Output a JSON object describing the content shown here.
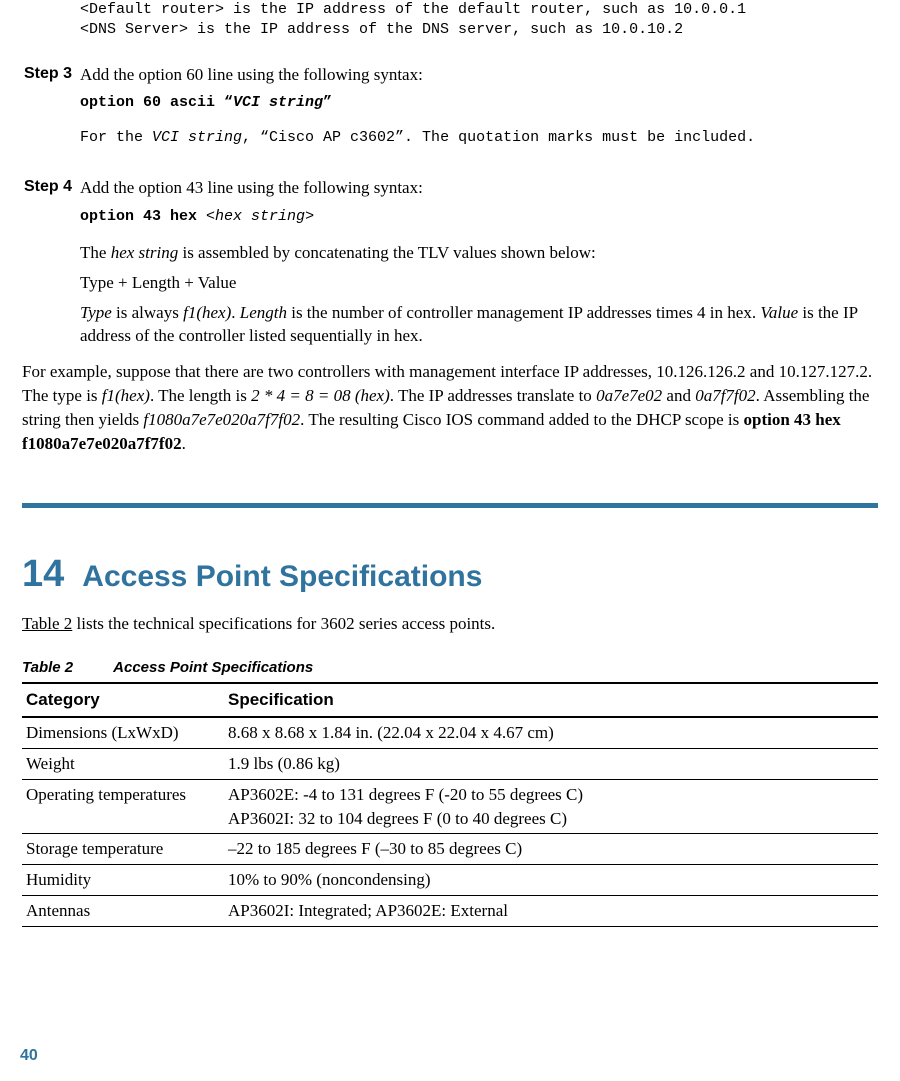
{
  "top_code": {
    "line1": "<Default router> is the IP address of the default router, such as 10.0.0.1",
    "line2": "<DNS Server> is the IP address of the DNS server, such as 10.0.10.2"
  },
  "step3": {
    "label": "Step 3",
    "text": "Add the option 60 line using the following syntax:",
    "syntax_prefix": "option 60 ascii “",
    "syntax_var": "VCI string",
    "syntax_suffix": "”",
    "note_prefix": "For the ",
    "note_var": "VCI string",
    "note_suffix": ", “Cisco AP c3602”. The quotation marks must be included."
  },
  "step4": {
    "label": "Step 4",
    "text": "Add the option 43 line using the following syntax:",
    "syntax_prefix": "option 43 hex ",
    "syntax_open": "<",
    "syntax_var": "hex string",
    "syntax_close": ">",
    "p1_pre": "The ",
    "p1_i1": "hex string",
    "p1_post": " is assembled by concatenating the TLV values shown below:",
    "p2": "Type + Length + Value",
    "p3_t1": "Type",
    "p3_s1": " is always ",
    "p3_t2": "f1(hex)",
    "p3_s2": ". ",
    "p3_t3": "Length",
    "p3_s3": " is the number of controller management IP addresses times 4 in hex. ",
    "p3_t4": "Value",
    "p3_s4": " is the IP address of the controller listed sequentially in hex."
  },
  "example": {
    "s1": "For example, suppose that there are two controllers with management interface IP addresses, 10.126.126.2 and 10.127.127.2. The type is ",
    "i1": "f1(hex)",
    "s2": ". The length is ",
    "i2": "2 * 4 = 8 = 08 (hex)",
    "s3": ". The IP addresses translate to ",
    "i3": "0a7e7e02",
    "s4": " and ",
    "i4": "0a7f7f02",
    "s5": ". Assembling the string then yields ",
    "i5": "f1080a7e7e020a7f7f02",
    "s6": ". The resulting Cisco IOS command added to the DHCP scope is ",
    "b1": "option 43 hex f1080a7e7e020a7f7f02",
    "s7": "."
  },
  "section": {
    "number": "14",
    "title": "Access Point Specifications",
    "intro_link": "Table 2",
    "intro_rest": " lists the technical specifications for 3602 series access points."
  },
  "table": {
    "label": "Table 2",
    "caption": "Access Point Specifications",
    "header": {
      "col1": "Category",
      "col2": "Specification"
    },
    "rows": [
      {
        "cat": "Dimensions (LxWxD)",
        "spec": "8.68 x 8.68 x 1.84 in. (22.04 x 22.04 x 4.67 cm)"
      },
      {
        "cat": "Weight",
        "spec": "1.9 lbs (0.86 kg)"
      },
      {
        "cat": "Operating temperatures",
        "spec": "AP3602E: -4 to 131 degrees F (-20 to 55 degrees C)\nAP3602I: 32 to 104 degrees F (0 to 40 degrees C)"
      },
      {
        "cat": "Storage temperature",
        "spec": "–22 to 185 degrees F (–30 to 85 degrees C)"
      },
      {
        "cat": "Humidity",
        "spec": "10% to 90% (noncondensing)"
      },
      {
        "cat": "Antennas",
        "spec": "AP3602I: Integrated; AP3602E: External"
      }
    ]
  },
  "page_number": "40"
}
